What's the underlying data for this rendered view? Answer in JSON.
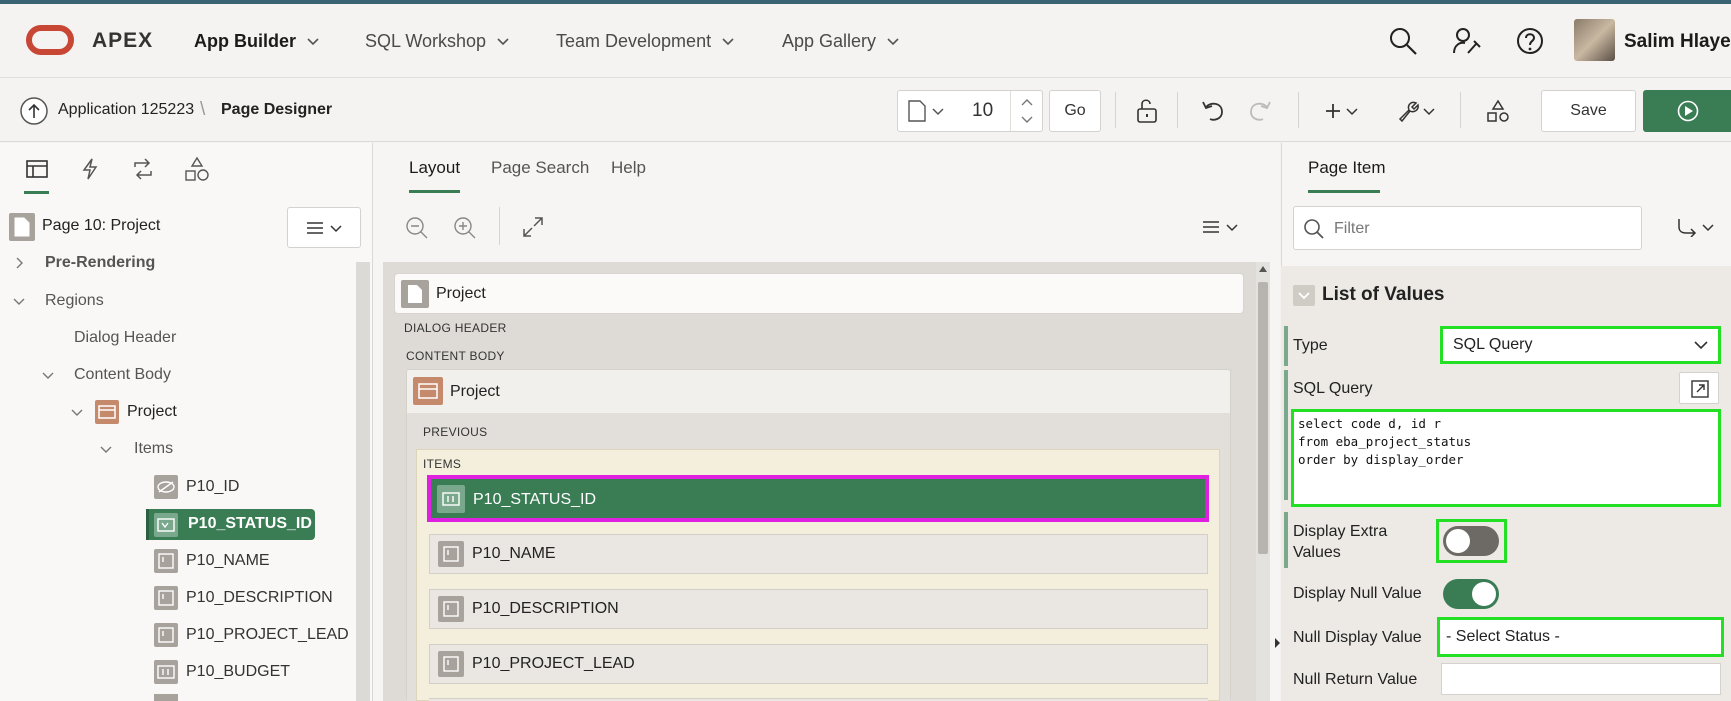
{
  "header": {
    "brand": "APEX",
    "nav": [
      {
        "label": "App Builder"
      },
      {
        "label": "SQL Workshop"
      },
      {
        "label": "Team Development"
      },
      {
        "label": "App Gallery"
      }
    ],
    "user_name": "Salim Hlayel"
  },
  "toolbar": {
    "breadcrumb_app": "Application 125223",
    "breadcrumb_sep": "\\",
    "breadcrumb_page": "Page Designer",
    "page_number": "10",
    "go_label": "Go",
    "save_label": "Save"
  },
  "left": {
    "page_title": "Page 10: Project",
    "tree": {
      "pre_rendering": "Pre-Rendering",
      "regions": "Regions",
      "dialog_header": "Dialog Header",
      "content_body": "Content Body",
      "project": "Project",
      "items": "Items",
      "item_list": [
        "P10_ID",
        "P10_STATUS_ID",
        "P10_NAME",
        "P10_DESCRIPTION",
        "P10_PROJECT_LEAD",
        "P10_BUDGET"
      ]
    }
  },
  "middle": {
    "tabs": [
      "Layout",
      "Page Search",
      "Help"
    ],
    "page_region": "Project",
    "dialog_header_label": "DIALOG HEADER",
    "content_body_label": "CONTENT BODY",
    "region_title": "Project",
    "previous_label": "PREVIOUS",
    "items_label": "ITEMS",
    "items": [
      "P10_STATUS_ID",
      "P10_NAME",
      "P10_DESCRIPTION",
      "P10_PROJECT_LEAD"
    ]
  },
  "right": {
    "tab": "Page Item",
    "filter_placeholder": "Filter",
    "section_title": "List of Values",
    "type_label": "Type",
    "type_value": "SQL Query",
    "sql_query_label": "SQL Query",
    "sql_query_value": "select code d, id r\nfrom eba_project_status\norder by display_order",
    "display_extra_label": "Display Extra Values",
    "display_extra_on": false,
    "display_null_label": "Display Null Value",
    "display_null_on": true,
    "null_display_label": "Null Display Value",
    "null_display_value": "- Select Status -",
    "null_return_label": "Null Return Value",
    "null_return_value": ""
  },
  "colors": {
    "accent_green": "#3a7d55",
    "highlight_green": "#24e024",
    "highlight_magenta": "#e020e0",
    "oracle_red": "#c74634"
  }
}
